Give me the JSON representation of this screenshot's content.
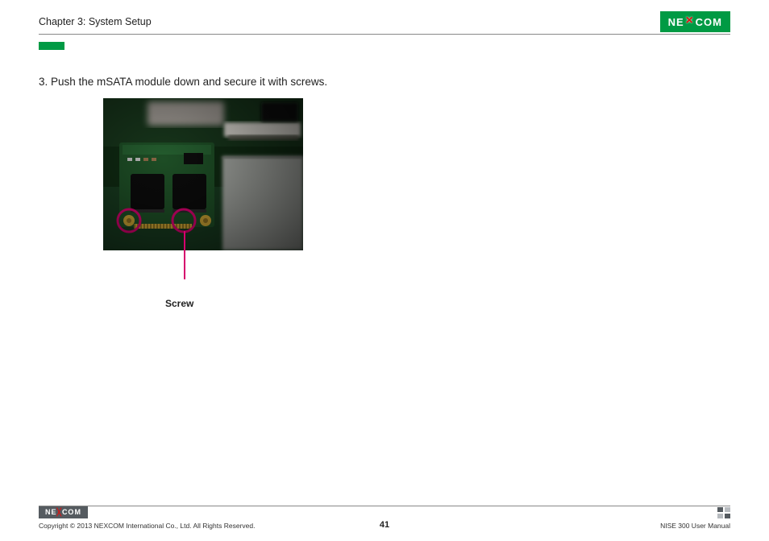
{
  "header": {
    "chapter": "Chapter 3: System Setup",
    "logo_text_left": "NE",
    "logo_text_right": "COM"
  },
  "body": {
    "step_text": "3. Push the mSATA module down and secure it with screws.",
    "callout_label": "Screw"
  },
  "footer": {
    "logo_text": "NE COM",
    "copyright": "Copyright © 2013 NEXCOM International Co., Ltd. All Rights Reserved.",
    "page_number": "41",
    "doc_name": "NISE 300 User Manual"
  }
}
